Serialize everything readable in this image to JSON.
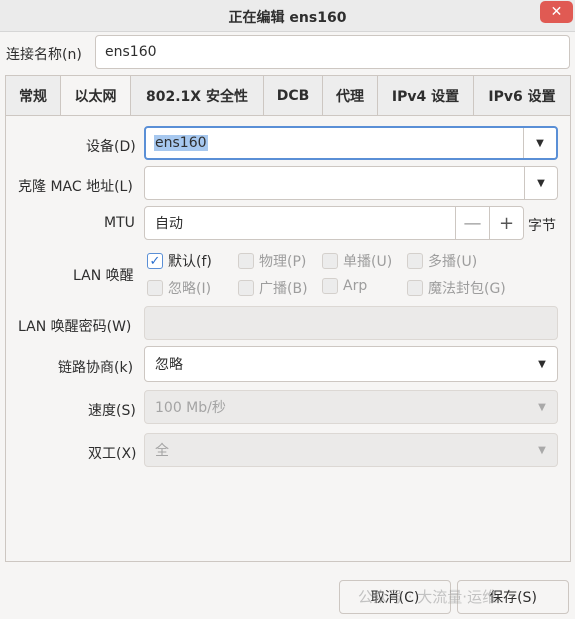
{
  "window": {
    "title": "正在编辑 ens160",
    "close_glyph": "✕"
  },
  "connection_name": {
    "label": "连接名称(n)",
    "value": "ens160"
  },
  "tabs": [
    {
      "label": "常规"
    },
    {
      "label": "以太网",
      "active": true
    },
    {
      "label": "802.1X 安全性"
    },
    {
      "label": "DCB"
    },
    {
      "label": "代理"
    },
    {
      "label": "IPv4 设置"
    },
    {
      "label": "IPv6 设置"
    }
  ],
  "ethernet": {
    "device": {
      "label": "设备(D)",
      "value": "ens160"
    },
    "cloned_mac": {
      "label": "克隆 MAC 地址(L)",
      "value": ""
    },
    "mtu": {
      "label": "MTU",
      "value": "自动",
      "unit": "字节",
      "minus": "—",
      "plus": "+"
    },
    "wake_on_lan": {
      "label": "LAN 唤醒",
      "options": [
        {
          "label": "默认(f)",
          "checked": true
        },
        {
          "label": "物理(P)",
          "checked": false
        },
        {
          "label": "单播(U)",
          "checked": false
        },
        {
          "label": "多播(U)",
          "checked": false
        },
        {
          "label": "忽略(I)",
          "checked": false
        },
        {
          "label": "广播(B)",
          "checked": false
        },
        {
          "label": "Arp",
          "checked": false
        },
        {
          "label": "魔法封包(G)",
          "checked": false
        }
      ]
    },
    "wol_password": {
      "label": "LAN 唤醒密码(W)",
      "value": ""
    },
    "link_negotiation": {
      "label": "链路协商(k)",
      "value": "忽略"
    },
    "speed": {
      "label": "速度(S)",
      "value": "100 Mb/秒"
    },
    "duplex": {
      "label": "双工(X)",
      "value": "全"
    }
  },
  "buttons": {
    "cancel": "取消(C)",
    "save": "保存(S)"
  },
  "watermark": "公众号 · 大流量·运维",
  "colors": {
    "close": "#e05a53",
    "focus": "#5a8fd6",
    "selection": "#a7c8ef"
  }
}
